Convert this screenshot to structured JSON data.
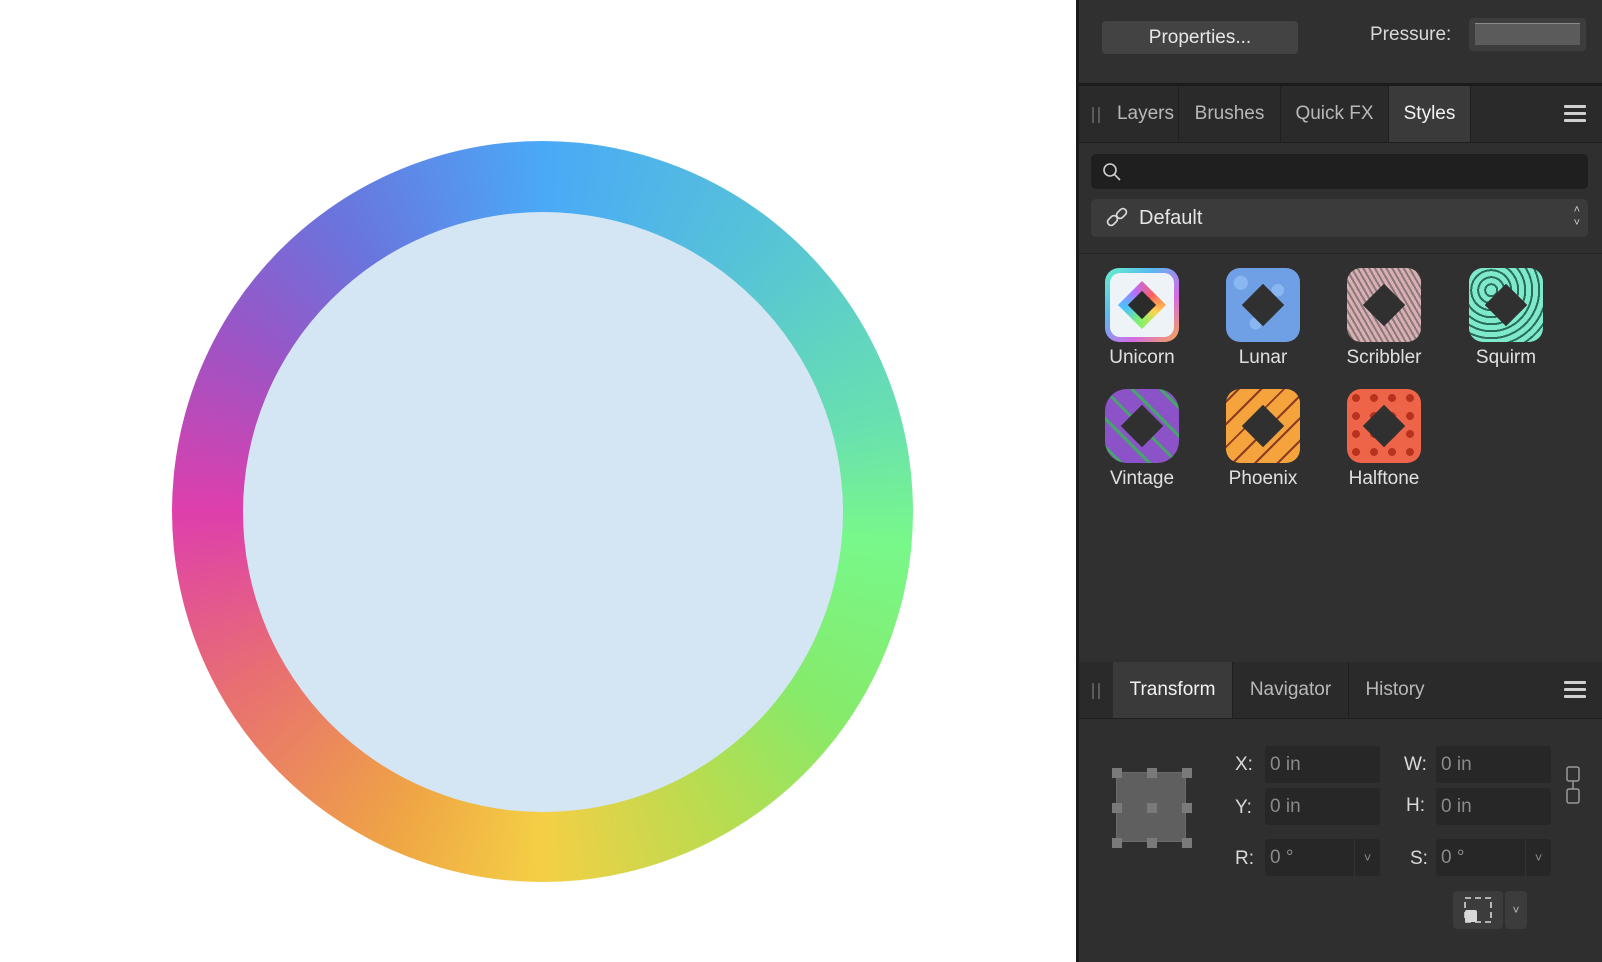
{
  "toolbar": {
    "properties_label": "Properties...",
    "pressure_label": "Pressure:"
  },
  "top_tabs": [
    "Layers",
    "Brushes",
    "Quick FX",
    "Styles"
  ],
  "styles": {
    "search_placeholder": "",
    "category": "Default",
    "items": [
      "Unicorn",
      "Lunar",
      "Scribbler",
      "Squirm",
      "Vintage",
      "Phoenix",
      "Halftone"
    ]
  },
  "bottom_tabs": [
    "Transform",
    "Navigator",
    "History"
  ],
  "transform": {
    "x_label": "X:",
    "x_value": "0 in",
    "y_label": "Y:",
    "y_value": "0 in",
    "w_label": "W:",
    "w_value": "0 in",
    "h_label": "H:",
    "h_value": "0 in",
    "r_label": "R:",
    "r_value": "0 °",
    "s_label": "S:",
    "s_value": "0 °"
  },
  "colors": {
    "panel_bg": "#2f2f2f",
    "inner_circle": "#d4e6f4"
  }
}
